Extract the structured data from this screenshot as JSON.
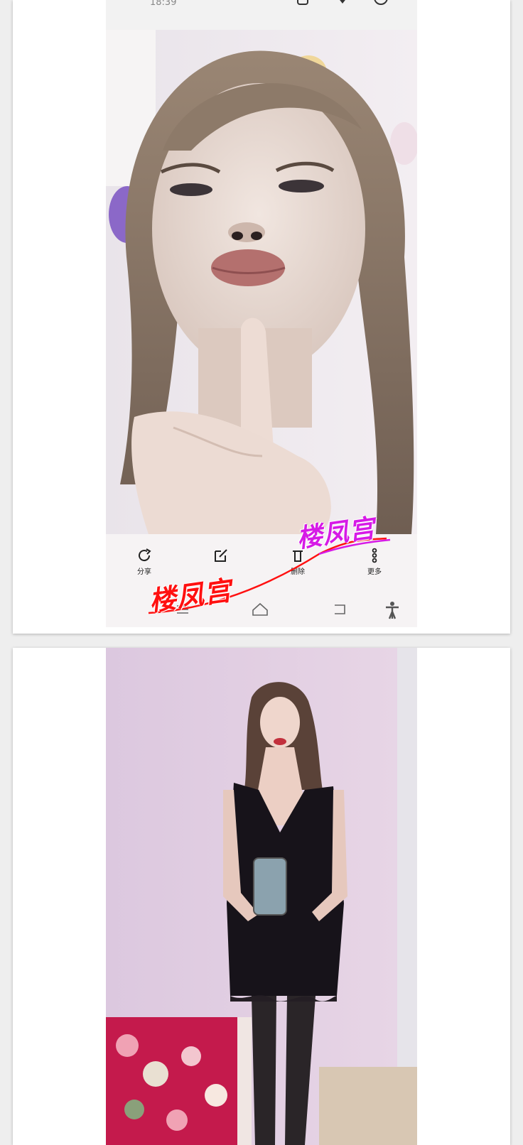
{
  "status_bar": {
    "time": "18:39"
  },
  "actions": [
    {
      "label": "分享",
      "icon": "share-icon"
    },
    {
      "label": "编辑",
      "icon": "edit-icon"
    },
    {
      "label": "删除",
      "icon": "delete-icon"
    },
    {
      "label": "更多",
      "icon": "more-icon"
    }
  ],
  "nav_icons": [
    "menu-icon",
    "home-icon",
    "back-icon",
    "accessibility-icon"
  ],
  "watermark": {
    "red_text": "楼凤宫",
    "purple_text": "楼凤宫",
    "red_color": "#ff1010",
    "purple_color": "#d61ae6"
  },
  "photos": [
    {
      "subject": "selfie-photo-1"
    },
    {
      "subject": "mirror-selfie-photo-2"
    }
  ]
}
